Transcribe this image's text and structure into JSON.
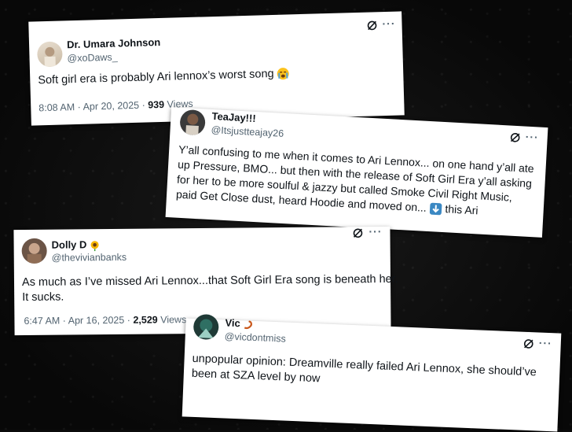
{
  "tweets": [
    {
      "name": "Dr. Umara Johnson",
      "handle": "@xoDaws_",
      "text": "Soft girl era is probably Ari lennox’s worst song",
      "emoji": "loudly-crying-face",
      "time": "8:08 AM · Apr 20, 2025 · ",
      "views_count": "939",
      "views_label": " Views"
    },
    {
      "name": "TeaJay!!!",
      "handle": "@Itsjustteajay26",
      "lines": [
        "Y’all confusing to me when it comes to Ari Lennox... on one hand y’all ate",
        "up Pressure, BMO... but then with the release of Soft Girl Era y’all asking",
        "for her to be more soulful & jazzy but called Smoke Civil Right Music,",
        "paid Get Close dust, heard Hoodie and moved on...",
        "this Ari"
      ],
      "emoji": "down-arrow"
    },
    {
      "name": "Dolly D",
      "name_emoji": "sunflower",
      "handle": "@thevivianbanks",
      "lines": [
        "As much as I’ve missed Ari Lennox...that Soft Girl Era song is beneath her.",
        "It sucks."
      ],
      "time": "6:47 AM · Apr 16, 2025 · ",
      "views_count": "2,529",
      "views_label": " Views"
    },
    {
      "name": "Vic",
      "name_emoji": "scorpion",
      "handle": "@vicdontmiss",
      "lines": [
        "unpopular opinion: Dreamville really failed Ari Lennox, she should’ve",
        "been at SZA level by now"
      ]
    }
  ],
  "icons": {
    "grok": "grok-icon",
    "more": "more-options-icon"
  },
  "more_glyph": "···",
  "colors": {
    "text": "#0f1419",
    "muted": "#536471",
    "background": "#0b0b0b"
  }
}
